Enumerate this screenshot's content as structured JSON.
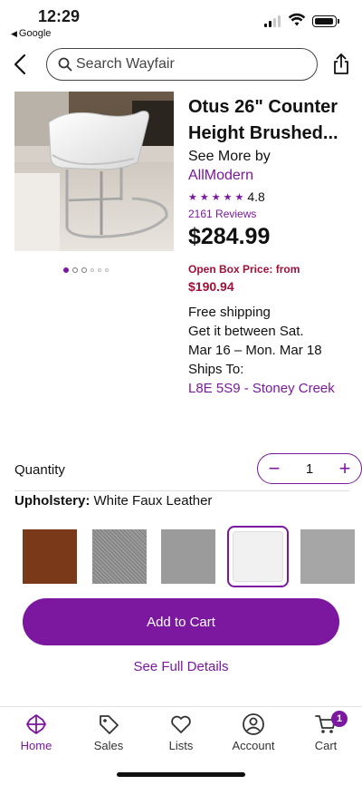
{
  "status_bar": {
    "time": "12:29",
    "back_app": "Google"
  },
  "header": {
    "search_placeholder": "Search Wayfair"
  },
  "product": {
    "title": "Otus 26\" Counter Height Brushed...",
    "title_line1": "Otus 26\" Counter",
    "title_line2": "Height Brushed...",
    "see_more": "See More by",
    "brand": "AllModern",
    "rating": "4.8",
    "rating_stars": 5,
    "reviews": "2161 Reviews",
    "price": "$284.99",
    "open_box_label": "Open Box Price: from",
    "open_box_price": "$190.94",
    "shipping_line1": "Free shipping",
    "shipping_line2": "Get it between Sat.",
    "shipping_line3": "Mar 16 – Mon. Mar 18",
    "ships_to_label": "Ships To:",
    "ships_to_location": "L8E 5S9 - Stoney Creek",
    "image_count": 6,
    "active_image": 1
  },
  "quantity": {
    "label": "Quantity",
    "value": "1"
  },
  "upholstery": {
    "label": "Upholstery:",
    "selected": "White Faux Leather",
    "swatches": [
      {
        "name": "brown",
        "color": "#7a3a1a"
      },
      {
        "name": "gray-tweed",
        "color": "#8a8a8a"
      },
      {
        "name": "gray",
        "color": "#9a9a9a"
      },
      {
        "name": "white",
        "color": "#f1f1f1",
        "selected": true
      },
      {
        "name": "light-gray",
        "color": "#a6a6a6"
      }
    ]
  },
  "actions": {
    "add_to_cart": "Add to Cart",
    "see_full_details": "See Full Details"
  },
  "bottom_nav": {
    "items": [
      {
        "label": "Home",
        "icon": "home-icon",
        "active": true
      },
      {
        "label": "Sales",
        "icon": "tag-icon"
      },
      {
        "label": "Lists",
        "icon": "heart-icon"
      },
      {
        "label": "Account",
        "icon": "account-icon"
      },
      {
        "label": "Cart",
        "icon": "cart-icon",
        "badge": "1"
      }
    ]
  },
  "colors": {
    "accent": "#7b189f",
    "open_box": "#a0103a"
  }
}
